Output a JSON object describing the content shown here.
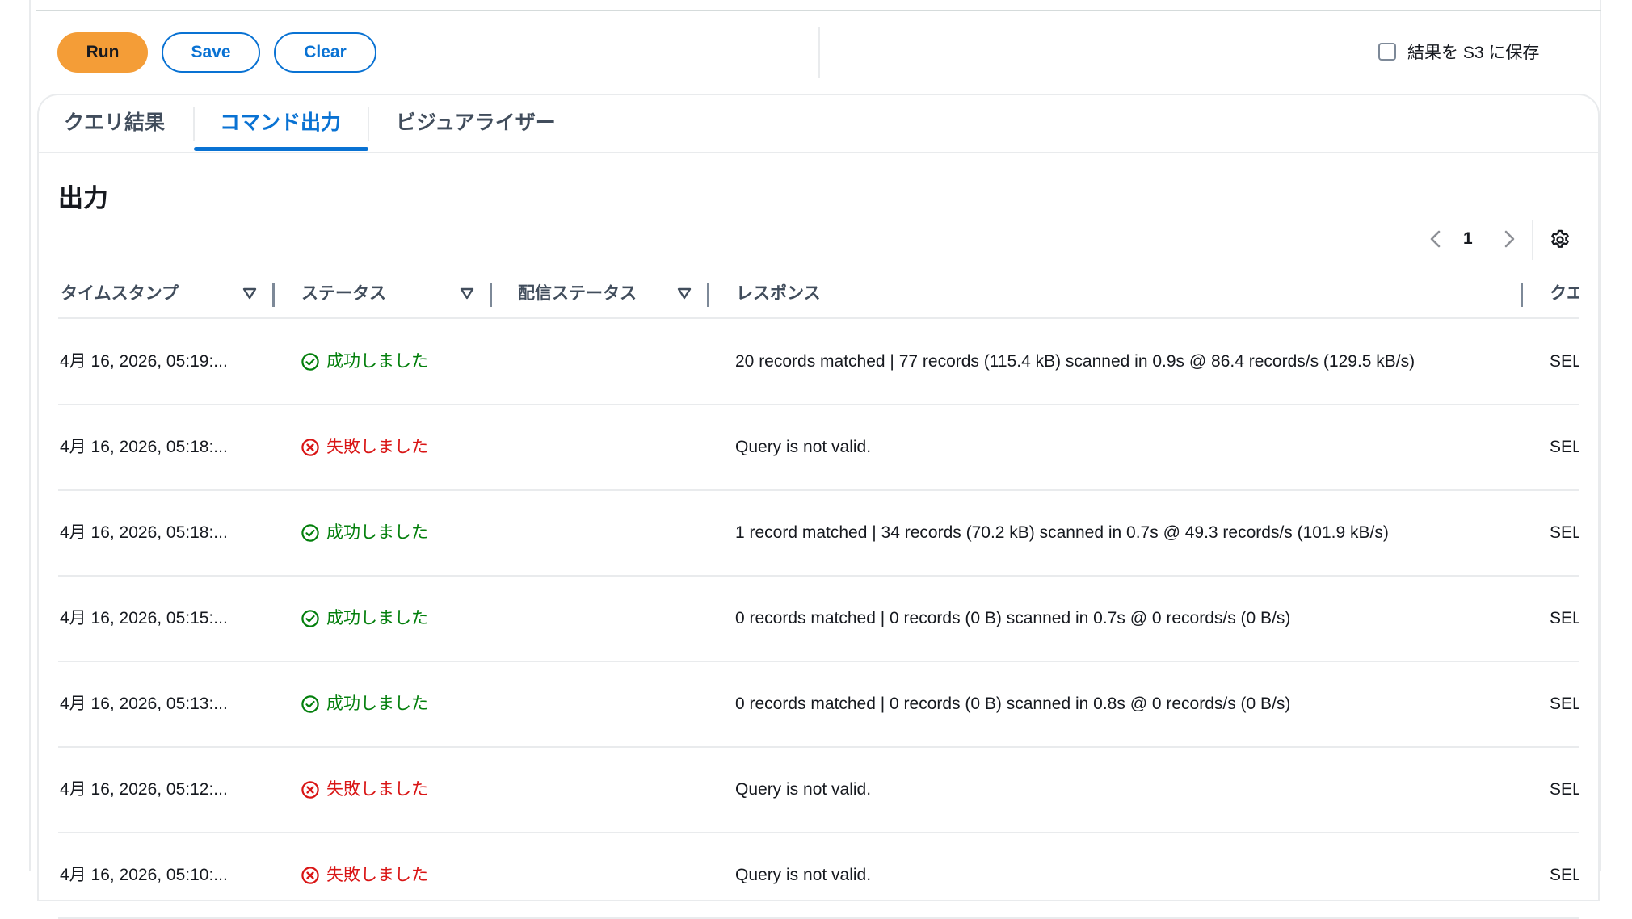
{
  "toolbar": {
    "run_label": "Run",
    "save_label": "Save",
    "clear_label": "Clear",
    "s3_label": "結果を S3 に保存"
  },
  "tabs": [
    {
      "label": "クエリ結果"
    },
    {
      "label": "コマンド出力"
    },
    {
      "label": "ビジュアライザー"
    }
  ],
  "active_tab": "コマンド出力",
  "section": {
    "title": "出力"
  },
  "pagination": {
    "current_page": "1"
  },
  "table": {
    "columns": [
      {
        "label": "タイムスタンプ"
      },
      {
        "label": "ステータス"
      },
      {
        "label": "配信ステータス"
      },
      {
        "label": "レスポンス"
      },
      {
        "label": "クエ"
      }
    ],
    "rows": [
      {
        "timestamp": "4月 16, 2026, 05:19:...",
        "status": "成功しました",
        "state": "success",
        "delivery": "",
        "response": "20 records matched | 77 records (115.4 kB) scanned in 0.9s @ 86.4 records/s (129.5 kB/s)",
        "query": "SEL"
      },
      {
        "timestamp": "4月 16, 2026, 05:18:...",
        "status": "失敗しました",
        "state": "error",
        "delivery": "",
        "response": "Query is not valid.",
        "query": "SEL"
      },
      {
        "timestamp": "4月 16, 2026, 05:18:...",
        "status": "成功しました",
        "state": "success",
        "delivery": "",
        "response": "1 record matched | 34 records (70.2 kB) scanned in 0.7s @ 49.3 records/s (101.9 kB/s)",
        "query": "SEL"
      },
      {
        "timestamp": "4月 16, 2026, 05:15:...",
        "status": "成功しました",
        "state": "success",
        "delivery": "",
        "response": "0 records matched | 0 records (0 B) scanned in 0.7s @ 0 records/s (0 B/s)",
        "query": "SEL"
      },
      {
        "timestamp": "4月 16, 2026, 05:13:...",
        "status": "成功しました",
        "state": "success",
        "delivery": "",
        "response": "0 records matched | 0 records (0 B) scanned in 0.8s @ 0 records/s (0 B/s)",
        "query": "SEL"
      },
      {
        "timestamp": "4月 16, 2026, 05:12:...",
        "status": "失敗しました",
        "state": "error",
        "delivery": "",
        "response": "Query is not valid.",
        "query": "SEL"
      },
      {
        "timestamp": "4月 16, 2026, 05:10:...",
        "status": "失敗しました",
        "state": "error",
        "delivery": "",
        "response": "Query is not valid.",
        "query": "SEL"
      }
    ]
  },
  "colors": {
    "accent": "#0972d3",
    "run_button": "#f49d37",
    "success": "#037f0c",
    "error": "#d91515"
  },
  "icons": {
    "success": "check-circle-icon",
    "error": "x-circle-icon",
    "settings": "gear-icon"
  }
}
